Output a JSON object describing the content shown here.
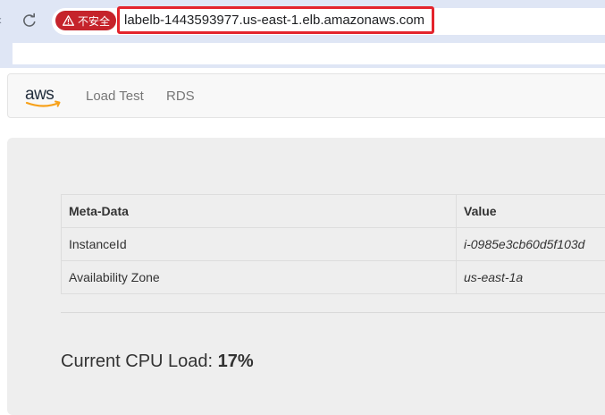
{
  "browser": {
    "security_label": "不安全",
    "url": "labelb-1443593977.us-east-1.elb.amazonaws.com",
    "colors": {
      "security_badge": "#c5232b",
      "url_highlight": "#e4242c",
      "chrome": "#dfe6f5"
    }
  },
  "navbar": {
    "logo_text": "aws",
    "links": [
      "Load Test",
      "RDS"
    ]
  },
  "table": {
    "headers": [
      "Meta-Data",
      "Value"
    ],
    "rows": [
      [
        "InstanceId",
        "i-0985e3cb60d5f103d"
      ],
      [
        "Availability Zone",
        "us-east-1a"
      ]
    ]
  },
  "cpu": {
    "label": "Current CPU Load:",
    "value": "17%"
  }
}
